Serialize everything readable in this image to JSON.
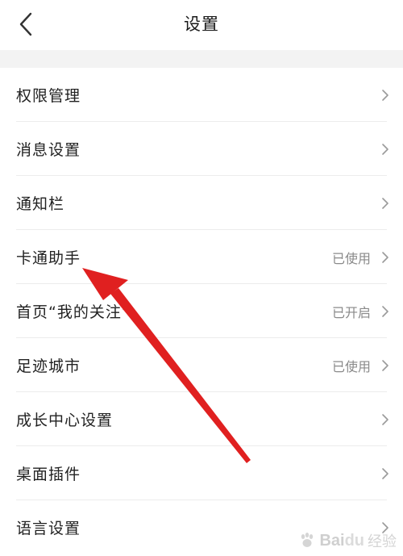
{
  "header": {
    "title": "设置",
    "back_icon": "chevron-left-icon"
  },
  "settings": {
    "items": [
      {
        "label": "权限管理",
        "status": ""
      },
      {
        "label": "消息设置",
        "status": ""
      },
      {
        "label": "通知栏",
        "status": ""
      },
      {
        "label": "卡通助手",
        "status": "已使用"
      },
      {
        "label": "首页“我的关注”",
        "status": "已开启"
      },
      {
        "label": "足迹城市",
        "status": "已使用"
      },
      {
        "label": "成长中心设置",
        "status": ""
      },
      {
        "label": "桌面插件",
        "status": ""
      },
      {
        "label": "语言设置",
        "status": ""
      }
    ]
  },
  "annotation": {
    "arrow_color": "#e02020"
  },
  "watermark": {
    "brand": "Bai",
    "brand_suffix": "du",
    "sub": "经验"
  }
}
